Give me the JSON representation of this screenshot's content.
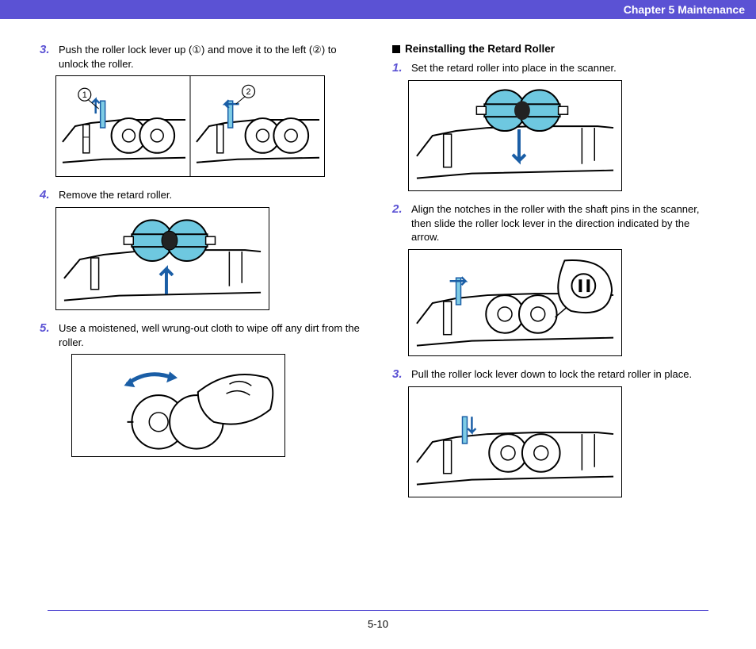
{
  "header": {
    "chapter": "Chapter 5   Maintenance"
  },
  "left": {
    "s3": {
      "num": "3.",
      "text": "Push the roller lock lever up (①) and move it to the left (②) to unlock the roller."
    },
    "s4": {
      "num": "4.",
      "text": "Remove the retard roller."
    },
    "s5": {
      "num": "5.",
      "text": "Use a moistened, well wrung-out cloth to wipe off any dirt from the roller."
    }
  },
  "right": {
    "section": "Reinstalling the Retard Roller",
    "s1": {
      "num": "1.",
      "text": "Set the retard roller into place in the scanner."
    },
    "s2": {
      "num": "2.",
      "text": "Align the notches in the roller with the shaft pins in the scanner, then slide the roller lock lever in the direction indicated by the arrow."
    },
    "s3": {
      "num": "3.",
      "text": "Pull the roller lock lever down to lock the retard roller in place."
    }
  },
  "footer": {
    "page": "5-10"
  }
}
